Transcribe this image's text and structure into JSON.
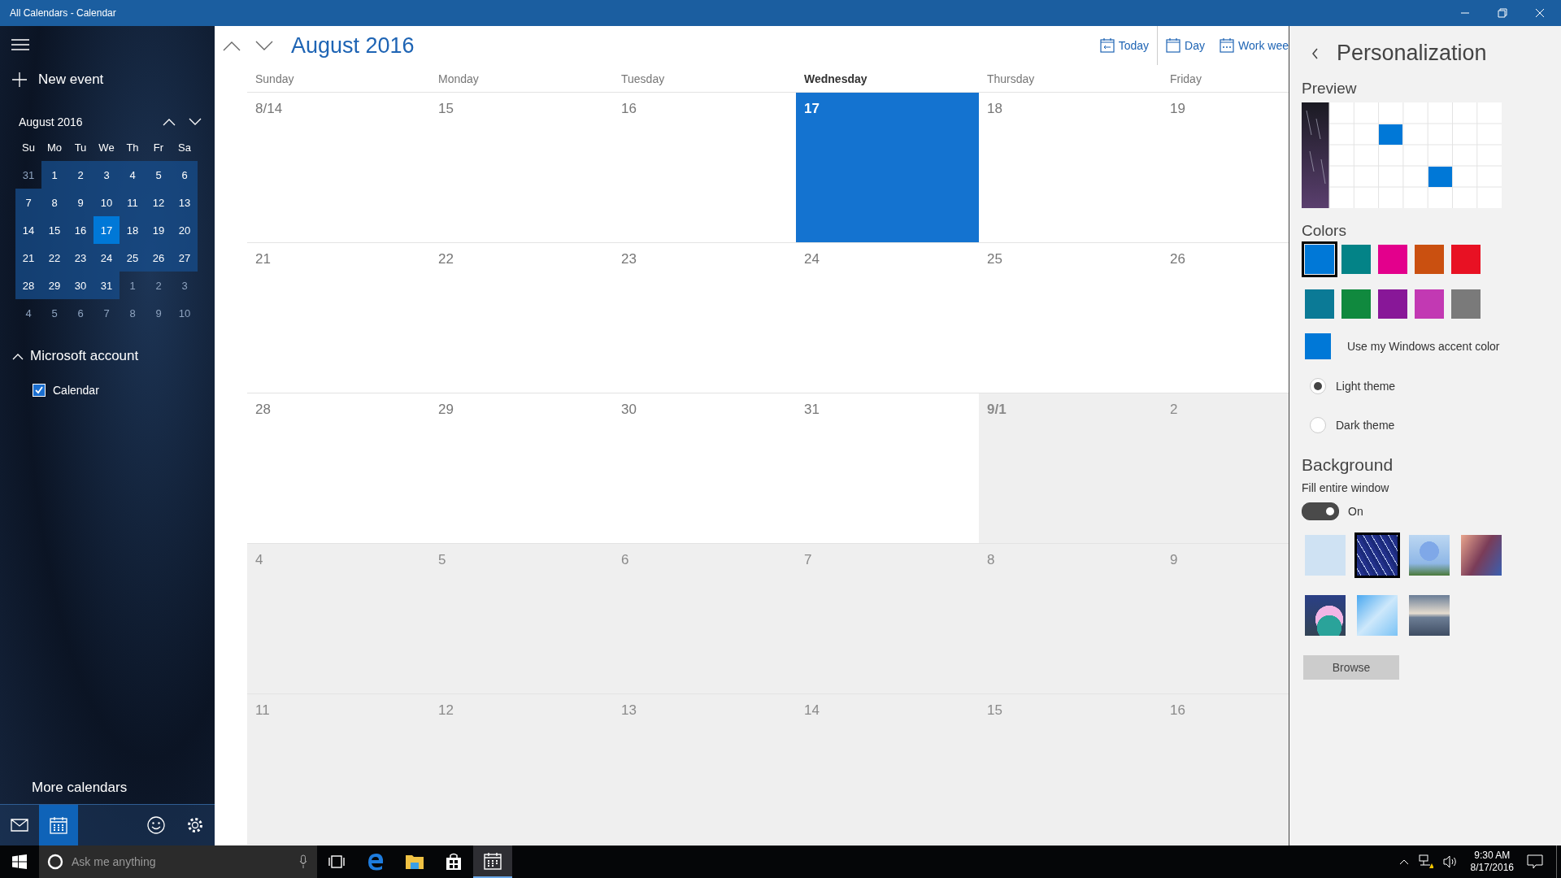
{
  "window": {
    "title": "All Calendars - Calendar"
  },
  "sidebar": {
    "new_event": "New event",
    "mini_calendar": {
      "title": "August 2016",
      "weekdays": [
        "Su",
        "Mo",
        "Tu",
        "We",
        "Th",
        "Fr",
        "Sa"
      ],
      "weeks": [
        [
          {
            "label": "31",
            "in_month": false,
            "selected": false
          },
          {
            "label": "1",
            "in_month": true,
            "selected": false
          },
          {
            "label": "2",
            "in_month": true,
            "selected": false
          },
          {
            "label": "3",
            "in_month": true,
            "selected": false
          },
          {
            "label": "4",
            "in_month": true,
            "selected": false
          },
          {
            "label": "5",
            "in_month": true,
            "selected": false
          },
          {
            "label": "6",
            "in_month": true,
            "selected": false
          }
        ],
        [
          {
            "label": "7",
            "in_month": true,
            "selected": false
          },
          {
            "label": "8",
            "in_month": true,
            "selected": false
          },
          {
            "label": "9",
            "in_month": true,
            "selected": false
          },
          {
            "label": "10",
            "in_month": true,
            "selected": false
          },
          {
            "label": "11",
            "in_month": true,
            "selected": false
          },
          {
            "label": "12",
            "in_month": true,
            "selected": false
          },
          {
            "label": "13",
            "in_month": true,
            "selected": false
          }
        ],
        [
          {
            "label": "14",
            "in_month": true,
            "selected": false
          },
          {
            "label": "15",
            "in_month": true,
            "selected": false
          },
          {
            "label": "16",
            "in_month": true,
            "selected": false
          },
          {
            "label": "17",
            "in_month": true,
            "selected": true
          },
          {
            "label": "18",
            "in_month": true,
            "selected": false
          },
          {
            "label": "19",
            "in_month": true,
            "selected": false
          },
          {
            "label": "20",
            "in_month": true,
            "selected": false
          }
        ],
        [
          {
            "label": "21",
            "in_month": true,
            "selected": false
          },
          {
            "label": "22",
            "in_month": true,
            "selected": false
          },
          {
            "label": "23",
            "in_month": true,
            "selected": false
          },
          {
            "label": "24",
            "in_month": true,
            "selected": false
          },
          {
            "label": "25",
            "in_month": true,
            "selected": false
          },
          {
            "label": "26",
            "in_month": true,
            "selected": false
          },
          {
            "label": "27",
            "in_month": true,
            "selected": false
          }
        ],
        [
          {
            "label": "28",
            "in_month": true,
            "selected": false
          },
          {
            "label": "29",
            "in_month": true,
            "selected": false
          },
          {
            "label": "30",
            "in_month": true,
            "selected": false
          },
          {
            "label": "31",
            "in_month": true,
            "selected": false
          },
          {
            "label": "1",
            "in_month": false,
            "selected": false
          },
          {
            "label": "2",
            "in_month": false,
            "selected": false
          },
          {
            "label": "3",
            "in_month": false,
            "selected": false
          }
        ],
        [
          {
            "label": "4",
            "in_month": false,
            "selected": false
          },
          {
            "label": "5",
            "in_month": false,
            "selected": false
          },
          {
            "label": "6",
            "in_month": false,
            "selected": false
          },
          {
            "label": "7",
            "in_month": false,
            "selected": false
          },
          {
            "label": "8",
            "in_month": false,
            "selected": false
          },
          {
            "label": "9",
            "in_month": false,
            "selected": false
          },
          {
            "label": "10",
            "in_month": false,
            "selected": false
          }
        ]
      ]
    },
    "accounts": [
      {
        "name": "Microsoft account",
        "expanded": true,
        "calendars": [
          {
            "name": "Calendar",
            "checked": true
          }
        ]
      }
    ],
    "more_calendars": "More calendars",
    "nav": [
      {
        "kind": "mail",
        "selected": false
      },
      {
        "kind": "calendar",
        "selected": true
      },
      {
        "kind": "feedback",
        "selected": false
      },
      {
        "kind": "settings",
        "selected": false
      }
    ]
  },
  "main": {
    "title": "August 2016",
    "toolbar": [
      {
        "kind": "today",
        "label": "Today"
      },
      {
        "kind": "day",
        "label": "Day"
      },
      {
        "kind": "workweek",
        "label": "Work wee"
      }
    ],
    "weekdays": [
      {
        "label": "Sunday",
        "selected": false
      },
      {
        "label": "Monday",
        "selected": false
      },
      {
        "label": "Tuesday",
        "selected": false
      },
      {
        "label": "Wednesday",
        "selected": true
      },
      {
        "label": "Thursday",
        "selected": false
      },
      {
        "label": "Friday",
        "selected": false
      }
    ],
    "weeks": [
      [
        {
          "label": "8/14",
          "in_month": true,
          "selected": false,
          "bold": false
        },
        {
          "label": "15",
          "in_month": true,
          "selected": false,
          "bold": false
        },
        {
          "label": "16",
          "in_month": true,
          "selected": false,
          "bold": false
        },
        {
          "label": "17",
          "in_month": true,
          "selected": true,
          "bold": true
        },
        {
          "label": "18",
          "in_month": true,
          "selected": false,
          "bold": false
        },
        {
          "label": "19",
          "in_month": true,
          "selected": false,
          "bold": false
        }
      ],
      [
        {
          "label": "21",
          "in_month": true,
          "selected": false,
          "bold": false
        },
        {
          "label": "22",
          "in_month": true,
          "selected": false,
          "bold": false
        },
        {
          "label": "23",
          "in_month": true,
          "selected": false,
          "bold": false
        },
        {
          "label": "24",
          "in_month": true,
          "selected": false,
          "bold": false
        },
        {
          "label": "25",
          "in_month": true,
          "selected": false,
          "bold": false
        },
        {
          "label": "26",
          "in_month": true,
          "selected": false,
          "bold": false
        }
      ],
      [
        {
          "label": "28",
          "in_month": true,
          "selected": false,
          "bold": false
        },
        {
          "label": "29",
          "in_month": true,
          "selected": false,
          "bold": false
        },
        {
          "label": "30",
          "in_month": true,
          "selected": false,
          "bold": false
        },
        {
          "label": "31",
          "in_month": true,
          "selected": false,
          "bold": false
        },
        {
          "label": "9/1",
          "in_month": false,
          "selected": false,
          "bold": true
        },
        {
          "label": "2",
          "in_month": false,
          "selected": false,
          "bold": false
        }
      ],
      [
        {
          "label": "4",
          "in_month": false,
          "selected": false,
          "bold": false
        },
        {
          "label": "5",
          "in_month": false,
          "selected": false,
          "bold": false
        },
        {
          "label": "6",
          "in_month": false,
          "selected": false,
          "bold": false
        },
        {
          "label": "7",
          "in_month": false,
          "selected": false,
          "bold": false
        },
        {
          "label": "8",
          "in_month": false,
          "selected": false,
          "bold": false
        },
        {
          "label": "9",
          "in_month": false,
          "selected": false,
          "bold": false
        }
      ],
      [
        {
          "label": "11",
          "in_month": false,
          "selected": false,
          "bold": false
        },
        {
          "label": "12",
          "in_month": false,
          "selected": false,
          "bold": false
        },
        {
          "label": "13",
          "in_month": false,
          "selected": false,
          "bold": false
        },
        {
          "label": "14",
          "in_month": false,
          "selected": false,
          "bold": false
        },
        {
          "label": "15",
          "in_month": false,
          "selected": false,
          "bold": false
        },
        {
          "label": "16",
          "in_month": false,
          "selected": false,
          "bold": false
        }
      ]
    ]
  },
  "panel": {
    "title": "Personalization",
    "preview_label": "Preview",
    "colors_label": "Colors",
    "colors": [
      {
        "color": "#0078d7",
        "selected": true
      },
      {
        "color": "#038387",
        "selected": false
      },
      {
        "color": "#e3008c",
        "selected": false
      },
      {
        "color": "#ca5010",
        "selected": false
      },
      {
        "color": "#e81123",
        "selected": false
      },
      {
        "color": "#0b7a96",
        "selected": false
      },
      {
        "color": "#10893e",
        "selected": false
      },
      {
        "color": "#881798",
        "selected": false
      },
      {
        "color": "#c239b3",
        "selected": false
      },
      {
        "color": "#7a7a7a",
        "selected": false
      }
    ],
    "accent": {
      "label": "Use my Windows accent color",
      "color": "#0078d7"
    },
    "themes": [
      {
        "label": "Light theme",
        "selected": true
      },
      {
        "label": "Dark theme",
        "selected": false
      }
    ],
    "background_label": "Background",
    "fill": {
      "label": "Fill entire window",
      "on": true,
      "state_label": "On"
    },
    "backgrounds": [
      {
        "kind": "plain",
        "selected": false
      },
      {
        "kind": "stars",
        "selected": true
      },
      {
        "kind": "tree",
        "selected": false
      },
      {
        "kind": "canyon",
        "selected": false
      },
      {
        "kind": "hills",
        "selected": false
      },
      {
        "kind": "polygons",
        "selected": false
      },
      {
        "kind": "lake",
        "selected": false
      }
    ],
    "browse": "Browse"
  },
  "taskbar": {
    "search_placeholder": "Ask me anything",
    "apps": [
      {
        "kind": "taskview",
        "active": false
      },
      {
        "kind": "edge",
        "active": false
      },
      {
        "kind": "explorer",
        "active": false
      },
      {
        "kind": "store",
        "active": false
      },
      {
        "kind": "calendar",
        "active": true
      }
    ],
    "clock": {
      "time": "9:30 AM",
      "date": "8/17/2016"
    }
  }
}
